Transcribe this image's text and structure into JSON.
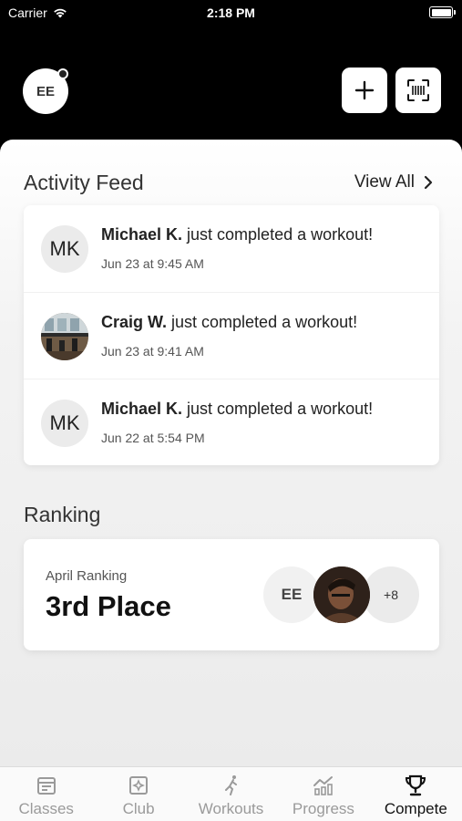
{
  "status_bar": {
    "carrier": "Carrier",
    "time": "2:18 PM",
    "battery_level": 1.0
  },
  "header": {
    "avatar_initials": "EE"
  },
  "activity_feed": {
    "title": "Activity Feed",
    "view_all_label": "View All",
    "items": [
      {
        "avatar": "MK",
        "name": "Michael K.",
        "action": " just completed a workout!",
        "time": "Jun 23 at 9:45 AM"
      },
      {
        "avatar": "",
        "name": "Craig W.",
        "action": " just completed a workout!",
        "time": "Jun 23 at 9:41 AM"
      },
      {
        "avatar": "MK",
        "name": "Michael K.",
        "action": " just completed a workout!",
        "time": "Jun 22 at 5:54 PM"
      }
    ]
  },
  "ranking": {
    "title": "Ranking",
    "label": "April Ranking",
    "value": "3rd Place",
    "avatar_initials": "EE",
    "more_count": "+8"
  },
  "tabs": [
    {
      "label": "Classes",
      "icon": "classes-icon",
      "active": false
    },
    {
      "label": "Club",
      "icon": "club-icon",
      "active": false
    },
    {
      "label": "Workouts",
      "icon": "workouts-icon",
      "active": false
    },
    {
      "label": "Progress",
      "icon": "progress-icon",
      "active": false
    },
    {
      "label": "Compete",
      "icon": "trophy-icon",
      "active": true
    }
  ],
  "colors": {
    "header_bg": "#000000",
    "active_tab": "#111111",
    "inactive_tab": "#9a9a9a"
  }
}
